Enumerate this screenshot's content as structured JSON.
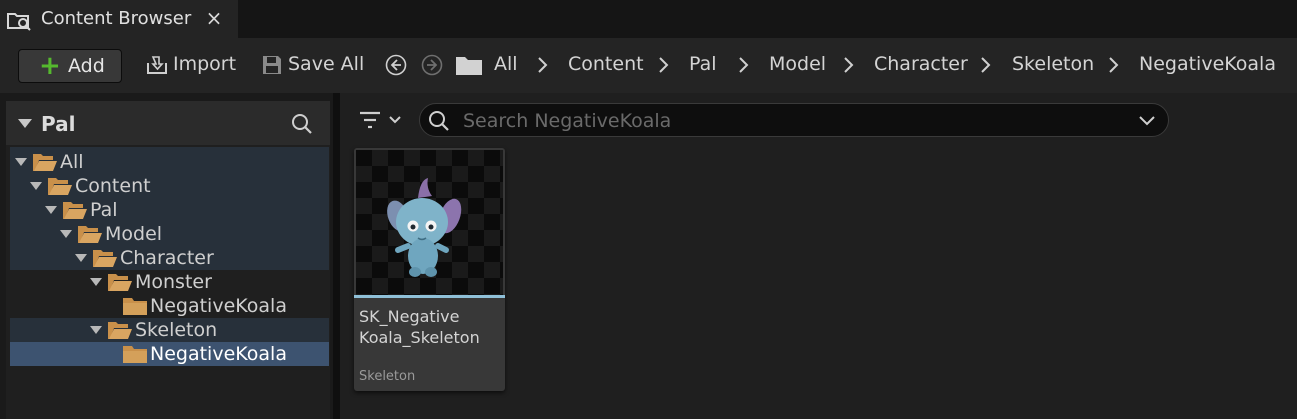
{
  "tab": {
    "title": "Content Browser",
    "close": "×"
  },
  "toolbar": {
    "add_label": "Add",
    "import_label": "Import",
    "save_all_label": "Save All"
  },
  "breadcrumb": [
    "All",
    "Content",
    "Pal",
    "Model",
    "Character",
    "Skeleton",
    "NegativeKoala"
  ],
  "sources": {
    "header": "Pal",
    "tree": [
      "All",
      "Content",
      "Pal",
      "Model",
      "Character",
      "Monster",
      "NegativeKoala",
      "Skeleton",
      "NegativeKoala"
    ],
    "selected": "NegativeKoala"
  },
  "search": {
    "placeholder": "Search NegativeKoala",
    "value": ""
  },
  "asset": {
    "name_line1": "SK_Negative",
    "name_line2": "Koala_Skeleton",
    "type": "Skeleton",
    "type_color": "#8fc0d8"
  },
  "colors": {
    "accent_green": "#55b92e",
    "folder": "#c9904a",
    "selection": "#3d5370"
  }
}
